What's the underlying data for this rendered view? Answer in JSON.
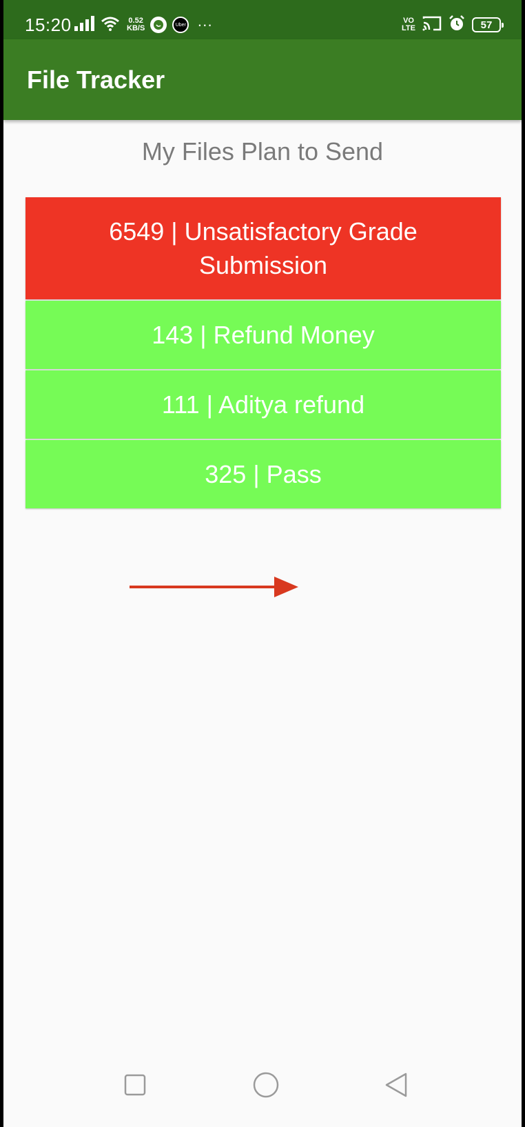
{
  "status_bar": {
    "time": "15:20",
    "net_speed_value": "0.52",
    "net_speed_unit": "KB/S",
    "uber_label": "Uber",
    "more": "···",
    "volte_top": "VO",
    "volte_bottom": "LTE",
    "battery": "57"
  },
  "app_bar": {
    "title": "File Tracker"
  },
  "main": {
    "heading": "My Files Plan to Send",
    "files": [
      {
        "label": "6549 | Unsatisfactory Grade Submission",
        "color": "#ee3425",
        "status": "red"
      },
      {
        "label": "143 | Refund Money",
        "color": "#76fb56",
        "status": "green"
      },
      {
        "label": "111 | Aditya refund",
        "color": "#76fb56",
        "status": "green"
      },
      {
        "label": "325 | Pass",
        "color": "#76fb56",
        "status": "green"
      }
    ]
  },
  "annotation": {
    "arrow_color": "#d8391f",
    "arrow_icon": "arrow-right-icon"
  },
  "nav_bar": {
    "recents_icon": "square-icon",
    "home_icon": "circle-icon",
    "back_icon": "triangle-back-icon"
  },
  "colors": {
    "status_bar": "#2d6b1c",
    "app_bar": "#3b7d23",
    "background": "#fafafa",
    "heading_text": "#7a7a7a"
  }
}
